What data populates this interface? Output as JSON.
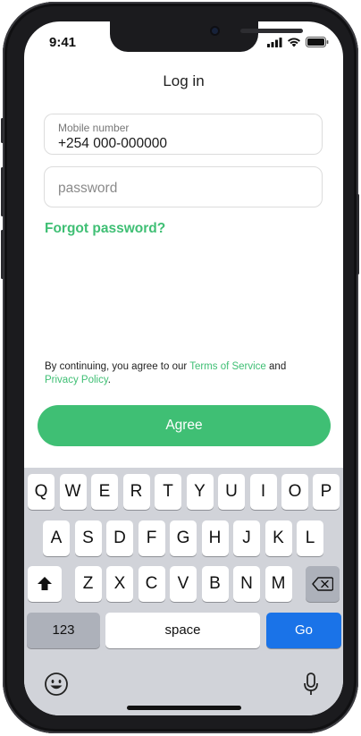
{
  "status_bar": {
    "time": "9:41"
  },
  "screen": {
    "title": "Log in"
  },
  "mobile": {
    "label": "Mobile number",
    "value": "+254 000-000000"
  },
  "password": {
    "placeholder": "password"
  },
  "forgot": {
    "label": "Forgot password?"
  },
  "terms": {
    "prefix": "By continuing, you agree to our ",
    "terms_link": "Terms of Service",
    "and": " and",
    "privacy_link": "Privacy Policy",
    "suffix": "."
  },
  "agree_button": {
    "label": "Agree"
  },
  "keyboard": {
    "row1": [
      "Q",
      "W",
      "E",
      "R",
      "T",
      "Y",
      "U",
      "I",
      "O",
      "P"
    ],
    "row2": [
      "A",
      "S",
      "D",
      "F",
      "G",
      "H",
      "J",
      "K",
      "L"
    ],
    "row3": [
      "Z",
      "X",
      "C",
      "V",
      "B",
      "N",
      "M"
    ],
    "numbers_key": "123",
    "space_key": "space",
    "go_key": "Go"
  },
  "colors": {
    "accent": "#3fbf74",
    "go": "#1a73e8",
    "frame": "#1b1b1e"
  },
  "icons": [
    "signal-icon",
    "wifi-icon",
    "battery-icon",
    "shift-icon",
    "backspace-icon",
    "emoji-icon",
    "microphone-icon"
  ]
}
